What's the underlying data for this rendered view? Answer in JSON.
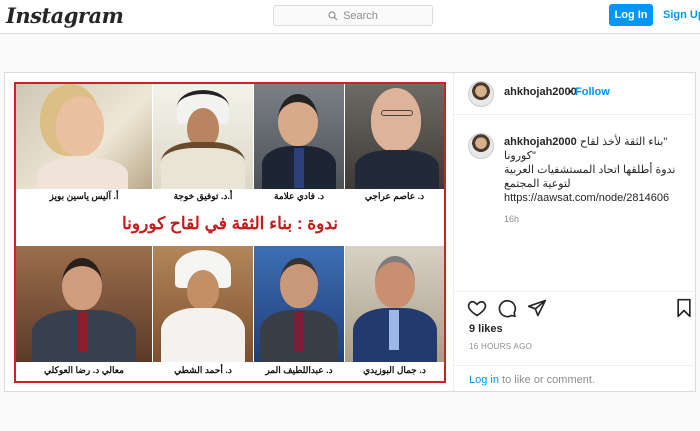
{
  "header": {
    "logo": "Instagram",
    "search_placeholder": "Search",
    "login_label": "Log In",
    "signup_label": "Sign Up"
  },
  "post": {
    "image": {
      "banner": "ندوة : بناء الثقة في لقاح كورونا",
      "people": [
        {
          "name": "أ. آليس ياسين بويز"
        },
        {
          "name": "أ.د. توفيق خوجة"
        },
        {
          "name": "د. فادي علامة"
        },
        {
          "name": "د. عاصم عراجي"
        },
        {
          "name": "معالي د. رضا العوكلي"
        },
        {
          "name": "د. أحمد الشطي"
        },
        {
          "name": "د. عبداللطيف المر"
        },
        {
          "name": "د. جمال البوزيدي"
        }
      ]
    },
    "author": "ahkhojah2000",
    "dot": "•",
    "follow_label": "Follow",
    "caption": {
      "username": "ahkhojah2000",
      "line1": "بناء الثقة لأخذ لقاح\"",
      "line2": "\"كورونا",
      "line3": "ندوة أطلقها اتحاد المستشفيات العربية",
      "line4": "لتوعية المجتمع",
      "url": "https://aawsat.com/node/2814606"
    },
    "caption_time": "16h",
    "likes": "9 likes",
    "posted_ago": "16 HOURS AGO",
    "login_prompt": {
      "link": "Log in",
      "rest": " to like or comment."
    }
  }
}
